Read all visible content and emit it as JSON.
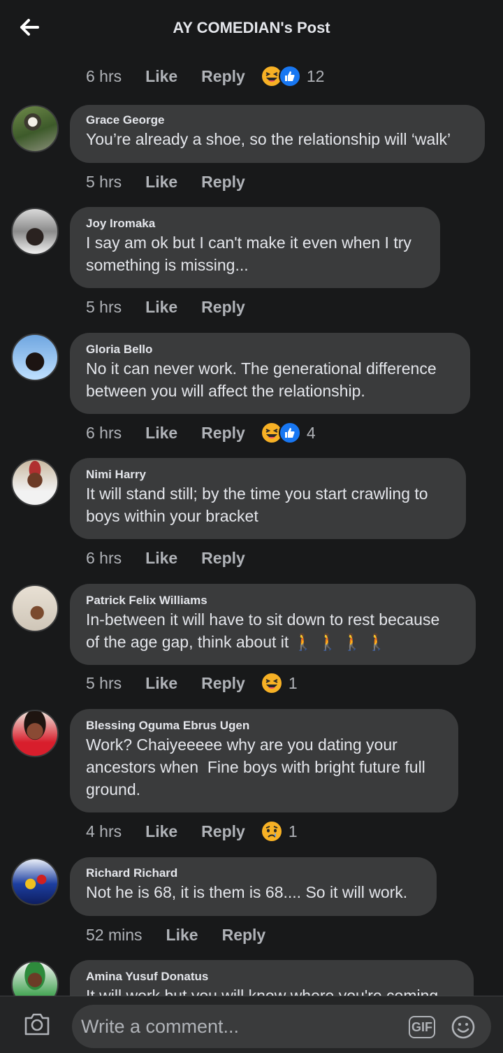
{
  "header": {
    "title": "AY COMEDIAN's Post",
    "back_icon": "arrow-left-icon"
  },
  "first_meta": {
    "time": "6 hrs",
    "like": "Like",
    "reply": "Reply",
    "reactions": [
      "haha",
      "like"
    ],
    "count": "12"
  },
  "comments": [
    {
      "author": "Grace George",
      "text": "You’re already a shoe, so the relationship will ‘walk’",
      "time": "5 hrs",
      "like": "Like",
      "reply": "Reply",
      "reactions": [],
      "count": ""
    },
    {
      "author": "Joy Iromaka",
      "text": "I say am ok but I can't make it even when I try\nsomething is missing...",
      "time": "5 hrs",
      "like": "Like",
      "reply": "Reply",
      "reactions": [],
      "count": ""
    },
    {
      "author": "Gloria Bello",
      "text": "No it can never work. The generational difference\nbetween you will affect the relationship.",
      "time": "6 hrs",
      "like": "Like",
      "reply": "Reply",
      "reactions": [
        "haha",
        "like"
      ],
      "count": "4"
    },
    {
      "author": "Nimi Harry",
      "text": "It will stand still; by the time you start crawling to\nboys within your bracket",
      "time": "6 hrs",
      "like": "Like",
      "reply": "Reply",
      "reactions": [],
      "count": ""
    },
    {
      "author": "Patrick Felix Williams",
      "text": "In-between it will have to sit down to rest because\nof the age gap, think about it 🚶 🚶 🚶 🚶",
      "time": "5 hrs",
      "like": "Like",
      "reply": "Reply",
      "reactions": [
        "haha"
      ],
      "count": "1"
    },
    {
      "author": "Blessing Oguma Ebrus Ugen",
      "text": "Work? Chaiyeeeee why are you dating your\nancestors when  Fine boys with bright future full\nground.",
      "time": "4 hrs",
      "like": "Like",
      "reply": "Reply",
      "reactions": [
        "sad"
      ],
      "count": "1"
    },
    {
      "author": "Richard Richard",
      "text": "Not he is 68, it is them is 68.... So it will work.",
      "time": "52 mins",
      "like": "Like",
      "reply": "Reply",
      "reactions": [],
      "count": ""
    },
    {
      "author": "Amina Yusuf Donatus",
      "text": "It will work but you will know where you're coming",
      "time": "",
      "like": "",
      "reply": "",
      "reactions": [],
      "count": ""
    }
  ],
  "composer": {
    "placeholder": "Write a comment...",
    "gif_label": "GIF",
    "camera_icon": "camera-icon",
    "emoji_icon": "smiley-icon"
  },
  "colors": {
    "background": "#18191a",
    "bubble": "#3a3b3c",
    "text": "#e4e6eb",
    "secondary": "#b0b3b8",
    "like_blue": "#1877f2",
    "haha_yellow": "#f7b125"
  }
}
